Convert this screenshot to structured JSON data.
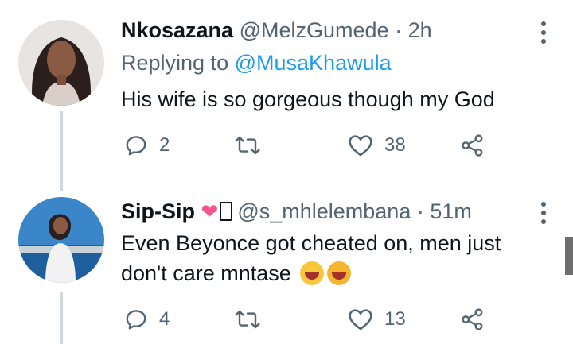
{
  "tweets": [
    {
      "name": "Nkosazana",
      "handle": "@MelzGumede",
      "separator": "·",
      "time": "2h",
      "replying_prefix": "Replying to",
      "replying_to": "@MusaKhawula",
      "text": "His wife is so gorgeous though my God",
      "replies": "2",
      "retweets": "",
      "likes": "38",
      "avatar_icon": "woman-braids-avatar"
    },
    {
      "name": "Sip-Sip",
      "name_emoji": "❤",
      "handle": "@s_mhlelembana",
      "separator": "·",
      "time": "51m",
      "text_line1": "Even Beyonce got cheated on, men just",
      "text_line2": "don't care mntase",
      "replies": "4",
      "retweets": "",
      "likes": "13",
      "avatar_icon": "woman-sea-avatar"
    }
  ],
  "colors": {
    "text": "#0f1419",
    "secondary": "#536471",
    "link": "#1d9bf0",
    "heart": "#f4558a",
    "thread_line": "#cfd9de"
  }
}
